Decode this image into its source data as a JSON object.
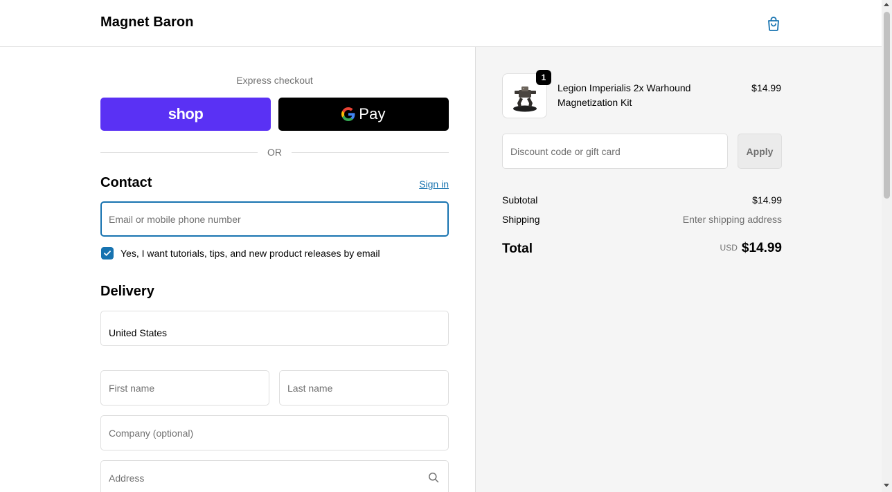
{
  "header": {
    "brand": "Magnet Baron",
    "cart_icon": "shopping-bag-icon"
  },
  "express": {
    "label": "Express checkout",
    "shop_pay_label": "shop",
    "gpay_label": "Pay",
    "or_label": "OR"
  },
  "contact": {
    "heading": "Contact",
    "sign_in": "Sign in",
    "email_placeholder": "Email or mobile phone number",
    "marketing_checkbox_label": "Yes, I want tutorials, tips, and new product releases by email",
    "marketing_checked": true
  },
  "delivery": {
    "heading": "Delivery",
    "country": "United States",
    "first_name_placeholder": "First name",
    "last_name_placeholder": "Last name",
    "company_placeholder": "Company (optional)",
    "address_placeholder": "Address"
  },
  "summary": {
    "product": {
      "name": "Legion Imperialis 2x Warhound Magnetization Kit",
      "price": "$14.99",
      "quantity": "1"
    },
    "discount_placeholder": "Discount code or gift card",
    "apply_label": "Apply",
    "subtotal_label": "Subtotal",
    "subtotal_value": "$14.99",
    "shipping_label": "Shipping",
    "shipping_value": "Enter shipping address",
    "total_label": "Total",
    "currency": "USD",
    "total_value": "$14.99"
  },
  "colors": {
    "accent": "#1773b0",
    "shop_pay": "#5a31f4",
    "summary_bg": "#f5f5f5"
  }
}
